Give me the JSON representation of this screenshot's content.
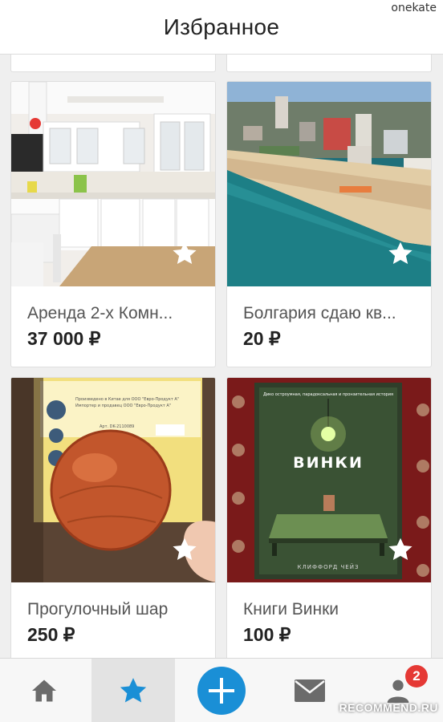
{
  "header": {
    "title": "Избранное"
  },
  "watermark_user": "onekate",
  "listings": [
    {
      "title": "Аренда 2-х Комн...",
      "price": "37 000 ₽",
      "image": "kitchen-photo"
    },
    {
      "title": "Болгария сдаю кв...",
      "price": "20 ₽",
      "image": "beach-resort-photo"
    },
    {
      "title": "Прогулочный шар",
      "price": "250 ₽",
      "image": "hamster-ball-photo"
    },
    {
      "title": "Книги Винки",
      "price": "100 ₽",
      "image": "book-cover-photo"
    }
  ],
  "book_cover": {
    "top_line": "Дико остроумная, парадоксальная и пронзительная история",
    "title": "ВИНКИ",
    "author": "КЛИФФОРД ЧЕЙЗ"
  },
  "package_text": {
    "line1": "Произведено в Китае для ООО \"Евро-Продукт А\"",
    "line2": "Импортер и продавец ООО \"Евро-Продукт А\"",
    "line3": "Арт. DK-2110089"
  },
  "bottom_nav": {
    "items": [
      {
        "name": "home",
        "icon": "home-icon"
      },
      {
        "name": "favorites",
        "icon": "star-icon",
        "active": true
      },
      {
        "name": "add",
        "icon": "plus-icon"
      },
      {
        "name": "messages",
        "icon": "mail-icon"
      },
      {
        "name": "profile",
        "icon": "user-icon"
      }
    ],
    "profile_badge": "2"
  },
  "watermark": "RECOMMEND.RU",
  "colors": {
    "accent": "#1a8fd6",
    "badge": "#e53935",
    "active_tab_bg": "#e3e3e3"
  }
}
